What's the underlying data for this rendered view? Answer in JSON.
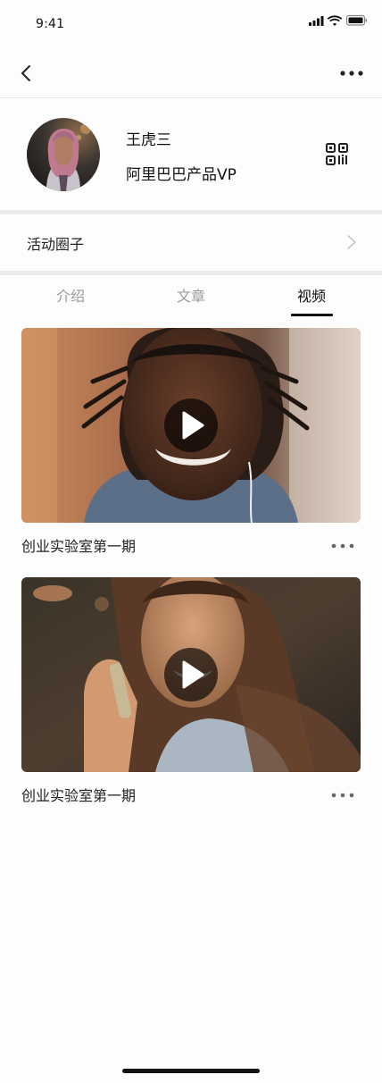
{
  "status_bar": {
    "time": "9:41"
  },
  "profile": {
    "name": "王虎三",
    "title": "阿里巴巴产品VP"
  },
  "activity_circle": {
    "label": "活动圈子"
  },
  "tabs": [
    {
      "label": "介绍",
      "active": false
    },
    {
      "label": "文章",
      "active": false
    },
    {
      "label": "视频",
      "active": true
    }
  ],
  "videos": [
    {
      "title": "创业实验室第一期"
    },
    {
      "title": "创业实验室第一期"
    }
  ],
  "icons": {
    "back": "chevron-left-icon",
    "more": "more-horizontal-icon",
    "qr": "qr-code-icon",
    "arrow": "chevron-right-icon",
    "play": "play-icon"
  },
  "colors": {
    "accent": "#111111",
    "muted_text": "#9a9a9a",
    "divider": "#ececec"
  }
}
